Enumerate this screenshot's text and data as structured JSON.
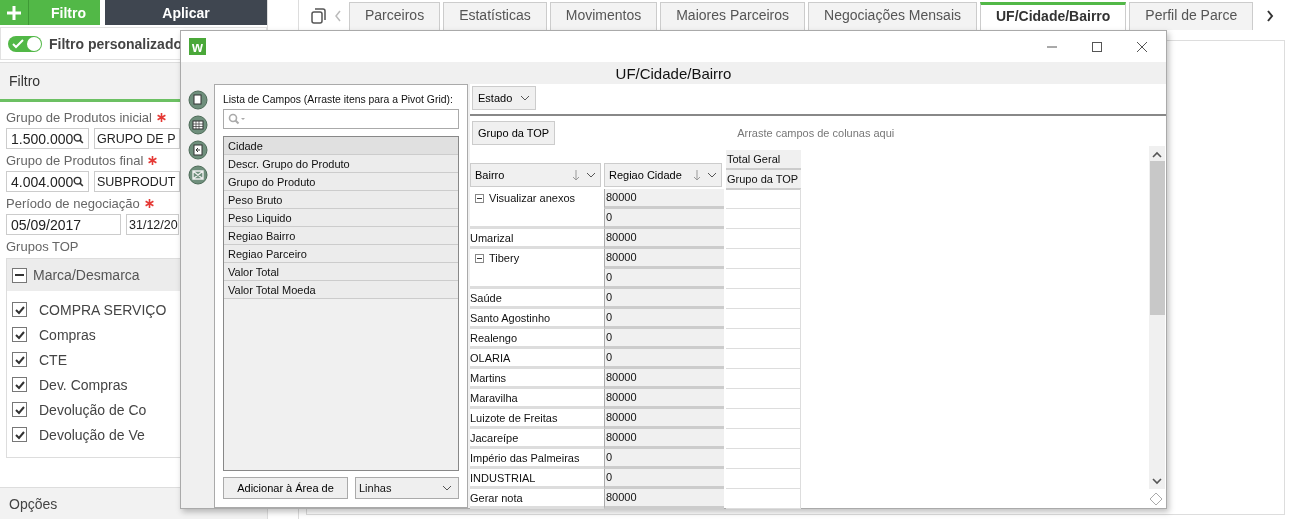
{
  "toolbar": {
    "filter_button": "Filtro",
    "apply_button": "Aplicar"
  },
  "custom_filter": {
    "label": "Filtro personalizado",
    "on": true
  },
  "filter": {
    "title": "Filtro",
    "lookups": [
      {
        "label": "Grupo de Produtos inicial",
        "required": true,
        "code": "1.500.000",
        "name": "GRUPO DE P"
      },
      {
        "label": "Grupo de Produtos final",
        "required": true,
        "code": "4.004.000",
        "name": "SUBPRODUT"
      }
    ],
    "period": {
      "label": "Período de negociação",
      "required": true,
      "start": "05/09/2017",
      "end": "31/12/20"
    },
    "top_groups": {
      "label": "Grupos TOP",
      "toggle_all": {
        "label": "Marca/Desmarca",
        "indeterminate": true
      },
      "items": [
        {
          "label": "COMPRA SERVIÇO",
          "checked": true
        },
        {
          "label": "Compras",
          "checked": true
        },
        {
          "label": "CTE",
          "checked": true
        },
        {
          "label": "Dev. Compras",
          "checked": true
        },
        {
          "label": "Devolução de Co",
          "checked": true
        },
        {
          "label": "Devolução de Ve",
          "checked": true
        }
      ]
    }
  },
  "options": {
    "title": "Opções"
  },
  "tabs": [
    {
      "label": "Parceiros",
      "selected": false
    },
    {
      "label": "Estatísticas",
      "selected": false
    },
    {
      "label": "Movimentos",
      "selected": false
    },
    {
      "label": "Maiores Parceiros",
      "selected": false
    },
    {
      "label": "Negociações Mensais",
      "selected": false
    },
    {
      "label": "UF/Cidade/Bairro",
      "selected": true
    },
    {
      "label": "Perfil de Parce",
      "selected": false
    }
  ],
  "dialog": {
    "logo": "w",
    "caption": "UF/Cidade/Bairro",
    "field_list": {
      "label": "Lista de Campos (Arraste itens para a Pivot Grid):",
      "items": [
        {
          "label": "Cidade",
          "selected": true
        },
        {
          "label": "Descr. Grupo do Produto",
          "selected": false
        },
        {
          "label": "Grupo do Produto",
          "selected": false
        },
        {
          "label": "Peso Bruto",
          "selected": false
        },
        {
          "label": "Peso Liquido",
          "selected": false
        },
        {
          "label": "Regiao Bairro",
          "selected": false
        },
        {
          "label": "Regiao Parceiro",
          "selected": false
        },
        {
          "label": "Valor Total",
          "selected": false
        },
        {
          "label": "Valor Total Moeda",
          "selected": false
        }
      ],
      "add_button": "Adicionar à Área de",
      "area_select": "Linhas"
    },
    "pivot": {
      "filter_fields": [
        "Estado"
      ],
      "data_fields": [
        "Grupo da TOP"
      ],
      "column_hint": "Arraste campos de colunas aqui",
      "column_headers": [
        "Total Geral",
        "Grupo da TOP"
      ],
      "row_fields": [
        "Bairro",
        "Regiao Cidade"
      ],
      "rows": [
        {
          "name": "Visualizar anexos",
          "kind": "group",
          "expanded": true,
          "values": [
            "80000",
            "0"
          ]
        },
        {
          "name": "Umarizal",
          "kind": "leaf",
          "values": [
            "80000"
          ]
        },
        {
          "name": "Tibery",
          "kind": "group",
          "expanded": true,
          "values": [
            "80000",
            "0"
          ]
        },
        {
          "name": "Saúde",
          "kind": "leaf",
          "values": [
            "0"
          ]
        },
        {
          "name": "Santo Agostinho",
          "kind": "leaf",
          "values": [
            "0"
          ]
        },
        {
          "name": "Realengo",
          "kind": "leaf",
          "values": [
            "0"
          ]
        },
        {
          "name": "OLARIA",
          "kind": "leaf",
          "values": [
            "0"
          ]
        },
        {
          "name": "Martins",
          "kind": "leaf",
          "values": [
            "80000"
          ]
        },
        {
          "name": "Maravilha",
          "kind": "leaf",
          "values": [
            "80000"
          ]
        },
        {
          "name": "Luizote de Freitas",
          "kind": "leaf",
          "values": [
            "80000"
          ]
        },
        {
          "name": "Jacareípe",
          "kind": "leaf",
          "values": [
            "80000"
          ]
        },
        {
          "name": "Império das Palmeiras",
          "kind": "leaf",
          "values": [
            "0"
          ]
        },
        {
          "name": "INDUSTRIAL",
          "kind": "leaf",
          "values": [
            "0"
          ]
        },
        {
          "name": "Gerar nota",
          "kind": "leaf",
          "values": [
            "80000"
          ]
        }
      ]
    }
  }
}
